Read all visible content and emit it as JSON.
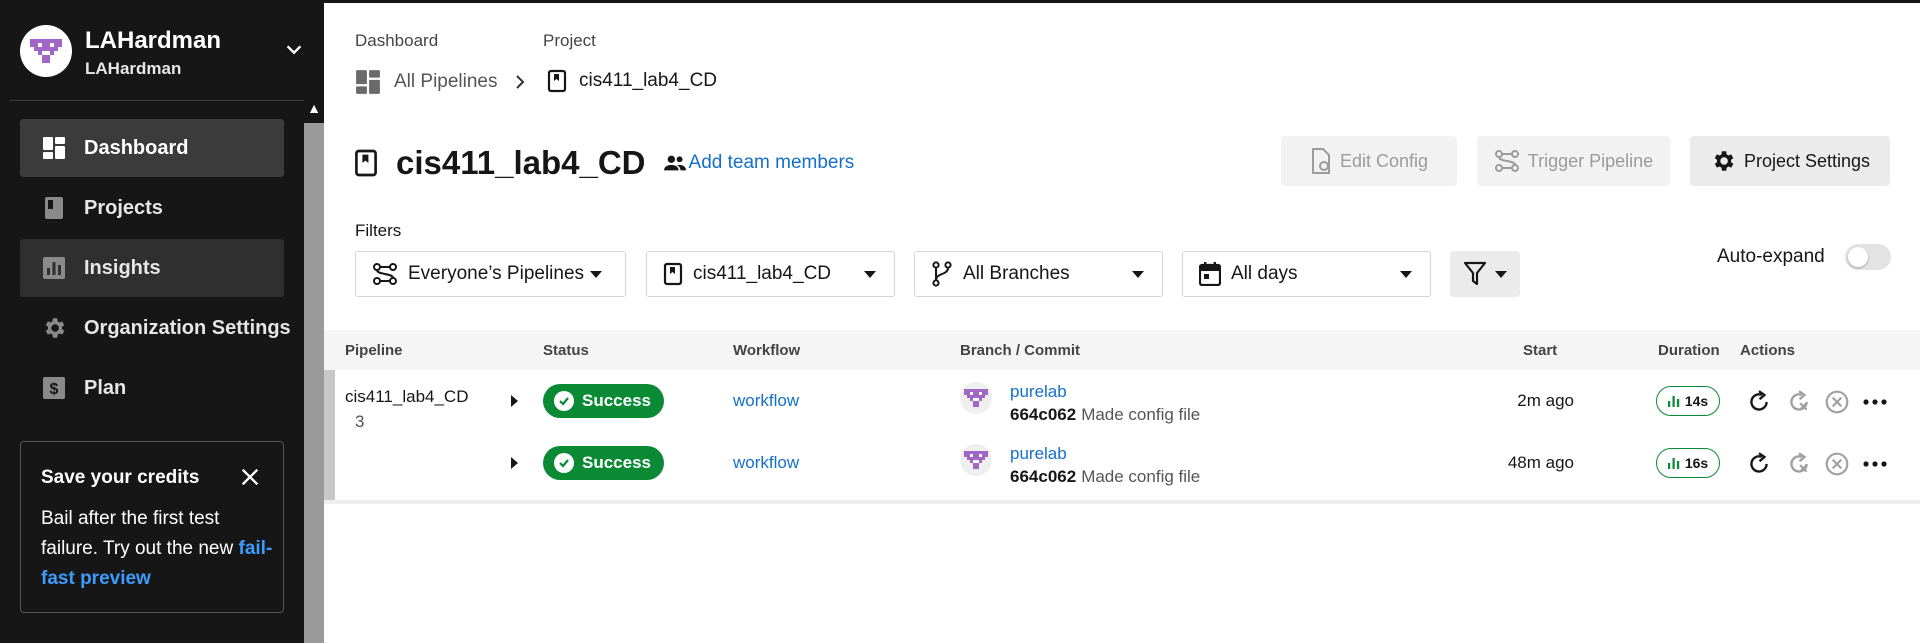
{
  "user": {
    "name": "LAHardman",
    "org": "LAHardman"
  },
  "sidebar": {
    "items": [
      {
        "label": "Dashboard",
        "icon": "dashboard-icon"
      },
      {
        "label": "Projects",
        "icon": "projects-icon"
      },
      {
        "label": "Insights",
        "icon": "insights-icon"
      },
      {
        "label": "Organization Settings",
        "icon": "gear-icon"
      },
      {
        "label": "Plan",
        "icon": "dollar-icon"
      }
    ],
    "credits": {
      "title": "Save your credits",
      "body": "Bail after the first test failure. Try out the new",
      "link": "fail-fast preview"
    }
  },
  "breadcrumb": {
    "dashboard_label": "Dashboard",
    "dashboard_value": "All Pipelines",
    "project_label": "Project",
    "project_value": "cis411_lab4_CD"
  },
  "page": {
    "title": "cis411_lab4_CD",
    "add_members": "Add team members",
    "buttons": {
      "edit_config": "Edit Config",
      "trigger_pipeline": "Trigger Pipeline",
      "project_settings": "Project Settings"
    }
  },
  "filters": {
    "label": "Filters",
    "pipelines": "Everyone’s Pipelines",
    "project": "cis411_lab4_CD",
    "branches": "All Branches",
    "days": "All days",
    "auto_expand": "Auto-expand"
  },
  "table": {
    "headers": {
      "pipeline": "Pipeline",
      "status": "Status",
      "workflow": "Workflow",
      "branch_commit": "Branch / Commit",
      "start": "Start",
      "duration": "Duration",
      "actions": "Actions"
    },
    "pipeline": {
      "name": "cis411_lab4_CD",
      "number": "3"
    },
    "rows": [
      {
        "status": "Success",
        "workflow": "workflow",
        "branch": "purelab",
        "commit_hash": "664c062",
        "commit_msg": "Made config file",
        "start": "2m ago",
        "duration": "14s"
      },
      {
        "status": "Success",
        "workflow": "workflow",
        "branch": "purelab",
        "commit_hash": "664c062",
        "commit_msg": "Made config file",
        "start": "48m ago",
        "duration": "16s"
      }
    ]
  },
  "colors": {
    "sidebar_bg": "#161616",
    "success": "#0a8a35",
    "link": "#1470cc",
    "avatar_purple": "#a067c7"
  }
}
